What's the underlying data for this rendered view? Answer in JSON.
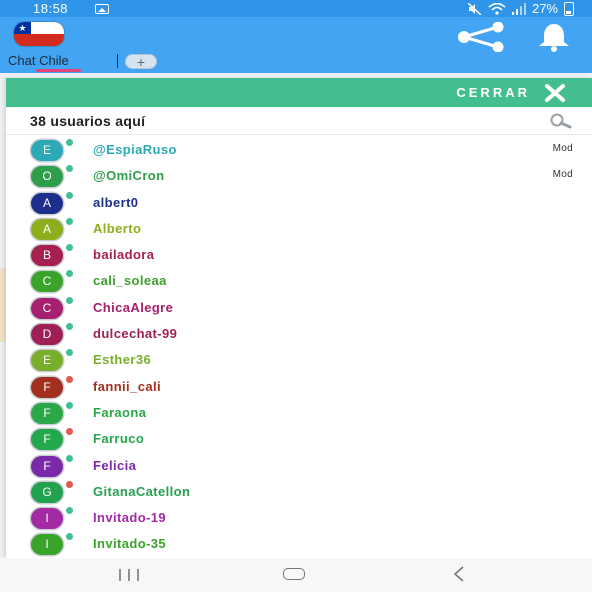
{
  "status_bar": {
    "time": "18:58",
    "battery_percent": "27%"
  },
  "header": {
    "tab_label": "Chat Chile",
    "add_tab_label": "+"
  },
  "drawer": {
    "close_label": "CERRAR",
    "users_count_label": "38 usuarios aquí",
    "users": [
      {
        "initial": "E",
        "name": "@EspiaRuso",
        "role": "Mod",
        "color": "#2ba9b6",
        "dot": "#43be8f"
      },
      {
        "initial": "O",
        "name": "@OmiCron",
        "role": "Mod",
        "color": "#2e9e4a",
        "dot": "#43be8f"
      },
      {
        "initial": "A",
        "name": "albert0",
        "role": "",
        "color": "#1e2e8c",
        "dot": "#43be8f"
      },
      {
        "initial": "A",
        "name": "Alberto",
        "role": "",
        "color": "#8fae1b",
        "dot": "#43be8f"
      },
      {
        "initial": "B",
        "name": "bailadora",
        "role": "",
        "color": "#a6204f",
        "dot": "#43be8f"
      },
      {
        "initial": "C",
        "name": "cali_soleaa",
        "role": "",
        "color": "#3aa32a",
        "dot": "#43be8f"
      },
      {
        "initial": "C",
        "name": "ChicaAlegre",
        "role": "",
        "color": "#a6206f",
        "dot": "#43be8f"
      },
      {
        "initial": "D",
        "name": "dulcechat-99",
        "role": "",
        "color": "#9e1f55",
        "dot": "#43be8f"
      },
      {
        "initial": "E",
        "name": "Esther36",
        "role": "",
        "color": "#79ae2a",
        "dot": "#43be8f"
      },
      {
        "initial": "F",
        "name": "fannii_cali",
        "role": "",
        "color": "#a3301e",
        "dot": "#e05a4e"
      },
      {
        "initial": "F",
        "name": "Faraona",
        "role": "",
        "color": "#2aa746",
        "dot": "#43be8f"
      },
      {
        "initial": "F",
        "name": "Farruco",
        "role": "",
        "color": "#23a84c",
        "dot": "#e05a4e"
      },
      {
        "initial": "F",
        "name": "Felicia",
        "role": "",
        "color": "#7a2aa8",
        "dot": "#43be8f"
      },
      {
        "initial": "G",
        "name": "GitanaCatellon",
        "role": "",
        "color": "#22a24f",
        "dot": "#e05a4e"
      },
      {
        "initial": "I",
        "name": "Invitado-19",
        "role": "",
        "color": "#a32aa3",
        "dot": "#43be8f"
      },
      {
        "initial": "I",
        "name": "Invitado-35",
        "role": "",
        "color": "#3aa32a",
        "dot": "#43be8f"
      }
    ]
  },
  "icons": {
    "share": "share-icon",
    "bell": "bell-icon",
    "close": "close-icon",
    "search": "search-icon"
  },
  "colors": {
    "status_bar": "#2f95ea",
    "header": "#42a4f3",
    "drawer_header": "#43be8f",
    "tab_indicator": "#e0467c"
  }
}
